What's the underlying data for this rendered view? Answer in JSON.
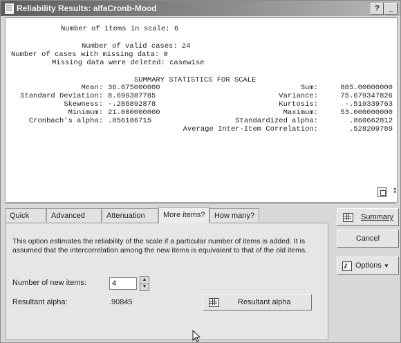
{
  "window": {
    "title": "Reliability Results: alfaCronb-Mood",
    "help_label": "?",
    "minimize_label": "_"
  },
  "output": {
    "items_line": "Number of items in scale: 6",
    "valid_line": "Number of valid cases: 24",
    "missing_line": "Number of cases with missing data: 0",
    "deleted_line": "Missing data were deleted: casewise",
    "summary_heading": "SUMMARY STATISTICS FOR SCALE",
    "stats_left": [
      {
        "label": "Mean:",
        "value": "36.875000000"
      },
      {
        "label": "Standard Deviation:",
        "value": "8.699387785"
      },
      {
        "label": "Skewness:",
        "value": "-.286892878"
      },
      {
        "label": "Minimum:",
        "value": "21.000000000"
      },
      {
        "label": "Cronbach's alpha:",
        "value": ".856186715"
      }
    ],
    "stats_right": [
      {
        "label": "Sum:",
        "value": "885.00000000"
      },
      {
        "label": "Variance:",
        "value": "75.679347826"
      },
      {
        "label": "Kurtosis:",
        "value": "-.519339763"
      },
      {
        "label": "Maximum:",
        "value": "53.000000000"
      },
      {
        "label": "Standardized alpha:",
        "value": ".860662812"
      }
    ],
    "avg_corr_label": "Average Inter-Item Correlation:",
    "avg_corr_value": ".528209789"
  },
  "tabs": [
    "Quick",
    "Advanced",
    "Attenuation",
    "More items?",
    "How many?"
  ],
  "active_tab": "More items?",
  "panel": {
    "description": "This option estimates the reliability of the scale if a particular number of items is added.  It is assumed that the intercorrelation among the new items is equivalent to that of the old items.",
    "new_items_label": "Number of new items:",
    "new_items_value": "4",
    "resultant_label": "Resultant alpha:",
    "resultant_value": ".90845",
    "resultant_button": "Resultant alpha"
  },
  "buttons": {
    "summary": "Summary",
    "cancel": "Cancel",
    "options": "Options"
  }
}
